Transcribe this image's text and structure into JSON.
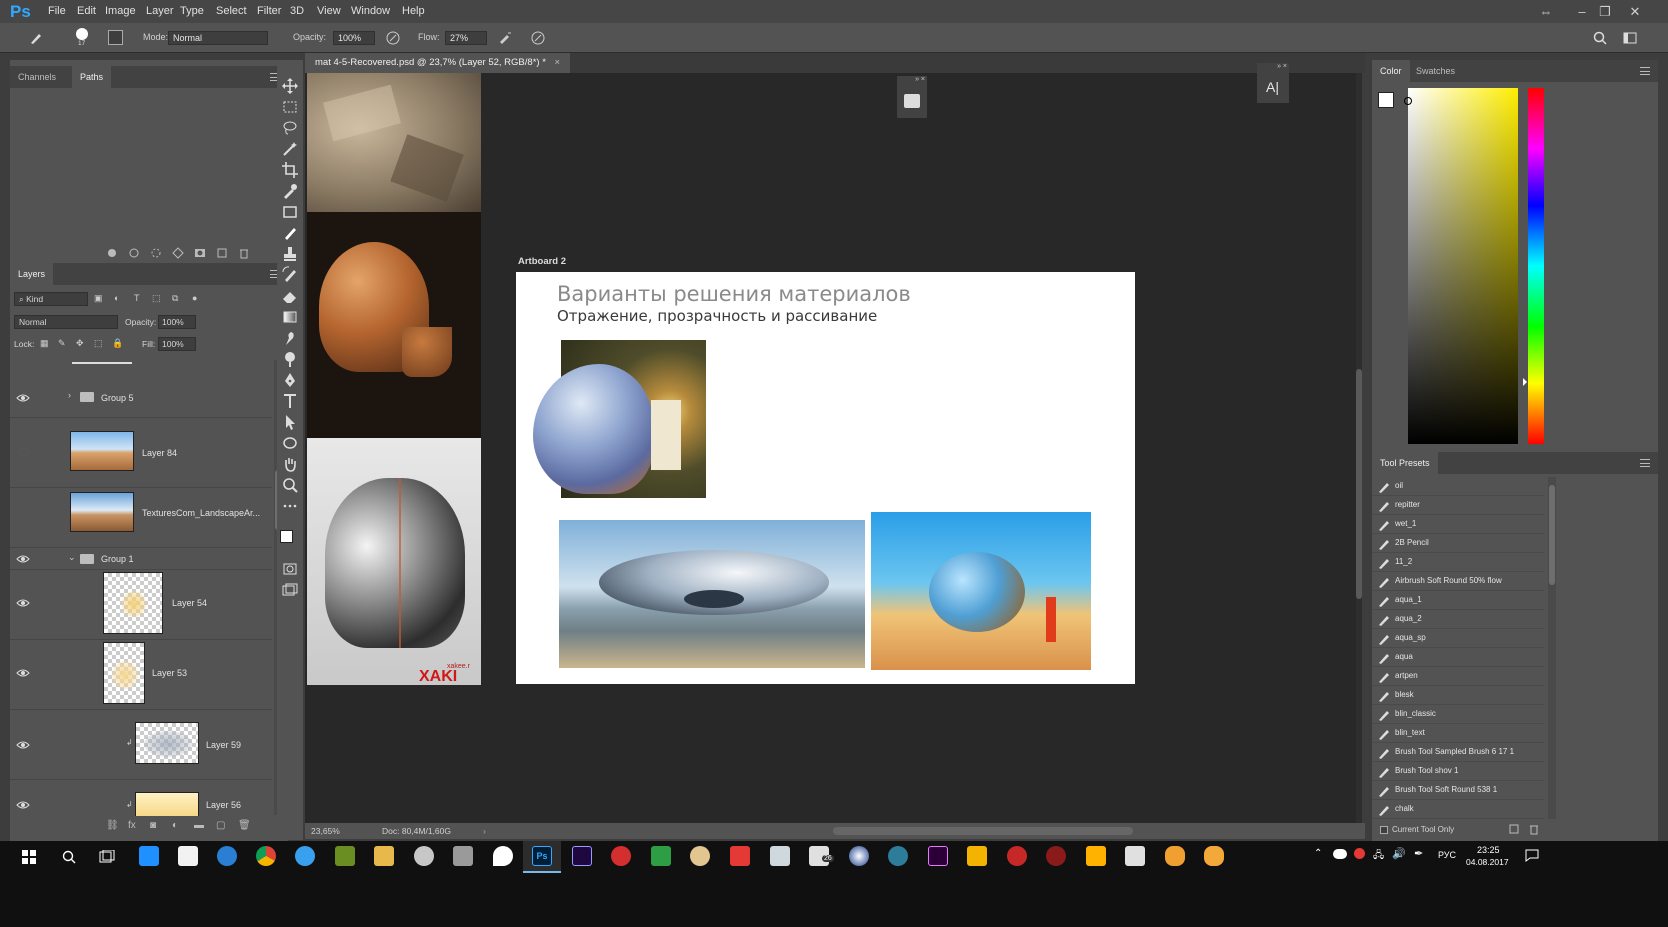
{
  "app": {
    "logo": "Ps"
  },
  "menu": [
    "File",
    "Edit",
    "Image",
    "Layer",
    "Type",
    "Select",
    "Filter",
    "3D",
    "View",
    "Window",
    "Help"
  ],
  "options": {
    "brush_size": "17",
    "mode_label": "Mode:",
    "mode_value": "Normal",
    "opacity_label": "Opacity:",
    "opacity_value": "100%",
    "flow_label": "Flow:",
    "flow_value": "27%"
  },
  "paths_panel": {
    "tabs": [
      "Channels",
      "Paths"
    ],
    "active_tab": "Paths"
  },
  "layers_panel": {
    "tab": "Layers",
    "filter_kind": "Kind",
    "blend_mode": "Normal",
    "opacity_label": "Opacity:",
    "opacity_value": "100%",
    "lock_label": "Lock:",
    "fill_label": "Fill:",
    "fill_value": "100%",
    "layers": [
      {
        "name": "Group 5",
        "type": "group",
        "visible": true
      },
      {
        "name": "Layer 84",
        "type": "layer",
        "visible": false
      },
      {
        "name": "TexturesCom_LandscapeAr...",
        "type": "layer",
        "visible": false
      },
      {
        "name": "Group 1",
        "type": "group",
        "visible": true
      },
      {
        "name": "Layer 54",
        "type": "layer",
        "visible": true
      },
      {
        "name": "Layer 53",
        "type": "layer",
        "visible": true
      },
      {
        "name": "Layer 59",
        "type": "layer",
        "visible": true
      },
      {
        "name": "Layer 56",
        "type": "layer",
        "visible": true
      }
    ]
  },
  "document": {
    "tab_title": "mat 4-5-Recovered.psd @ 23,7% (Layer 52, RGB/8*) *",
    "artboard_label": "Artboard 2",
    "artboard_title": "Варианты решения материалов",
    "artboard_subtitle": "Отражение, прозрачность и рассивание",
    "zoom": "23,65%",
    "doc_info": "Doc: 80,4M/1,60G",
    "watermark": "xakee.r",
    "watermark_big": "XAKI"
  },
  "color_panel": {
    "tabs": [
      "Color",
      "Swatches"
    ],
    "active_tab": "Color"
  },
  "tool_presets": {
    "title": "Tool Presets",
    "items": [
      "oil",
      "repitter",
      "wet_1",
      "2B Pencil",
      "11_2",
      "Airbrush Soft Round 50% flow",
      "aqua_1",
      "aqua_2",
      "aqua_sp",
      "aqua",
      "artpen",
      "blesk",
      "blin_classic",
      "blin_text",
      "Brush Tool Sampled Brush 6 17 1",
      "Brush Tool shov 1",
      "Brush Tool Soft Round 538 1",
      "chalk"
    ],
    "current_tool_only": "Current Tool Only"
  },
  "taskbar": {
    "lang": "РУС",
    "time": "23:25",
    "date": "04.08.2017",
    "mail_badge": "26"
  },
  "colors": {
    "accent_blue": "#31a8ff",
    "panel_bg": "#535353",
    "canvas_bg": "#282828"
  }
}
